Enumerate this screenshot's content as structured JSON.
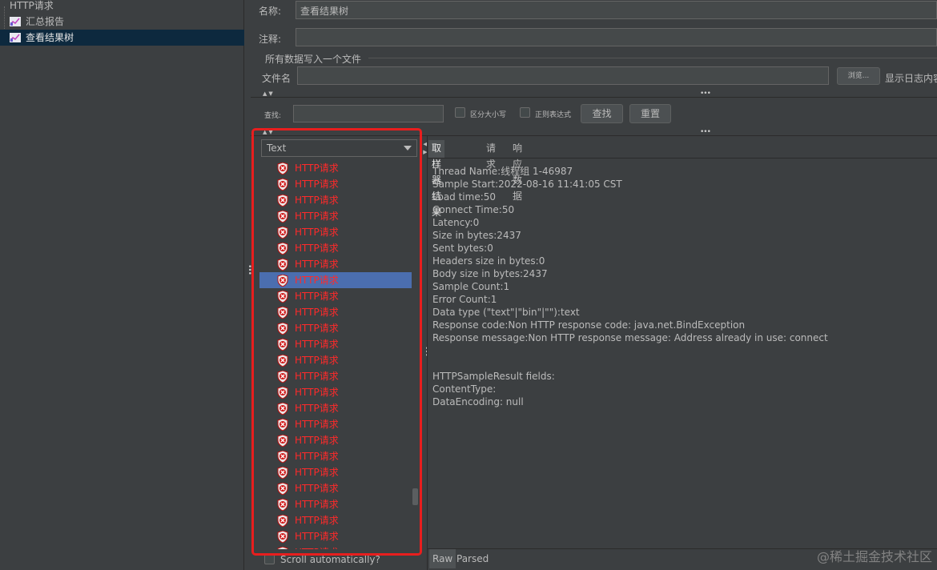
{
  "tree": {
    "root": "HTTP请求",
    "children": [
      "汇总报告",
      "查看结果树"
    ]
  },
  "config": {
    "name_label": "名称:",
    "name_value": "查看结果树",
    "comment_label": "注释:",
    "comment_value": "",
    "group_title": "所有数据写入一个文件",
    "filename_label": "文件名",
    "filename_value": "",
    "browse_button": "浏览...",
    "log_display_label": "显示日志内容"
  },
  "search": {
    "label": "查找:",
    "value": "",
    "case_label": "区分大小写",
    "regex_label": "正则表达式",
    "find_button": "查找",
    "reset_button": "重置"
  },
  "results": {
    "renderer": "Text",
    "item_label": "HTTP请求",
    "item_count": 25,
    "selected_index": 7,
    "item_status": "error",
    "scroll_auto_label": "Scroll automatically?"
  },
  "detail": {
    "tabs": [
      "取样器结果",
      "请求",
      "响应数据"
    ],
    "active_tab": 0,
    "lines": [
      "Thread Name:线程组 1-46987",
      "Sample Start:2022-08-16 11:41:05 CST",
      "Load time:50",
      "Connect Time:50",
      "Latency:0",
      "Size in bytes:2437",
      "Sent bytes:0",
      "Headers size in bytes:0",
      "Body size in bytes:2437",
      "Sample Count:1",
      "Error Count:1",
      "Data type (\"text\"|\"bin\"|\"\"):text",
      "Response code:Non HTTP response code: java.net.BindException",
      "Response message:Non HTTP response message: Address already in use: connect",
      "",
      "",
      "HTTPSampleResult fields:",
      "ContentType:",
      "DataEncoding: null"
    ],
    "bottom_tabs": [
      "Raw",
      "Parsed"
    ]
  },
  "watermark": "@稀土掘金技术社区",
  "colors": {
    "background": "#3c3f41",
    "error_text": "#ff2a2a",
    "selection": "#4b6eaf",
    "highlight_frame": "#e81e1e"
  }
}
